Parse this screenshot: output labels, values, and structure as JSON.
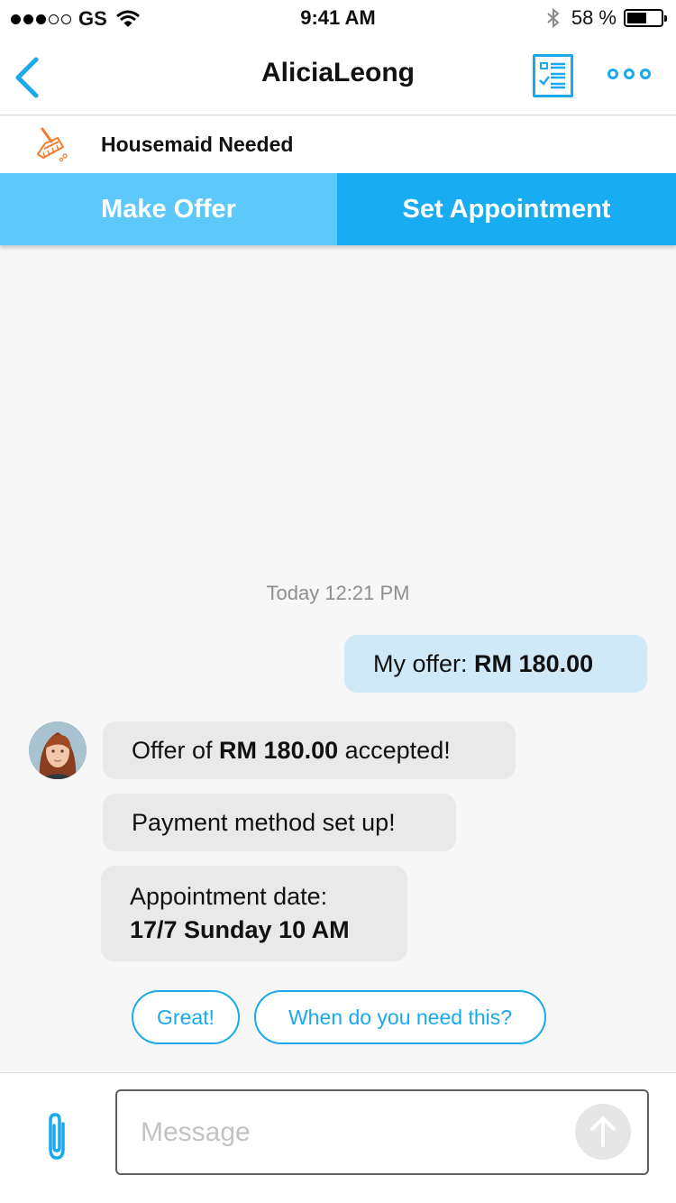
{
  "status_bar": {
    "carrier": "GS",
    "time": "9:41 AM",
    "battery": "58 %",
    "battery_level": 0.58
  },
  "header": {
    "title": "AliciaLeong"
  },
  "job": {
    "title": "Housemaid Needed"
  },
  "actions": {
    "make_offer": "Make Offer",
    "set_appointment": "Set Appointment"
  },
  "chat": {
    "timestamp": "Today 12:21 PM",
    "my_offer": {
      "prefix": "My offer: ",
      "amount": "RM 180.00"
    },
    "accepted": {
      "prefix": "Offer of ",
      "amount": "RM 180.00",
      "suffix": " accepted!"
    },
    "payment": "Payment method set up!",
    "appointment": {
      "label": "Appointment date:",
      "value": "17/7 Sunday 10 AM"
    }
  },
  "quick_replies": [
    "Great!",
    "When do you need this?"
  ],
  "composer": {
    "placeholder": "Message"
  },
  "colors": {
    "accent": "#1aa9ec",
    "offer_button": "#5cc9fa",
    "appointment_button": "#18adf2",
    "broom_icon": "#f07c2c"
  }
}
